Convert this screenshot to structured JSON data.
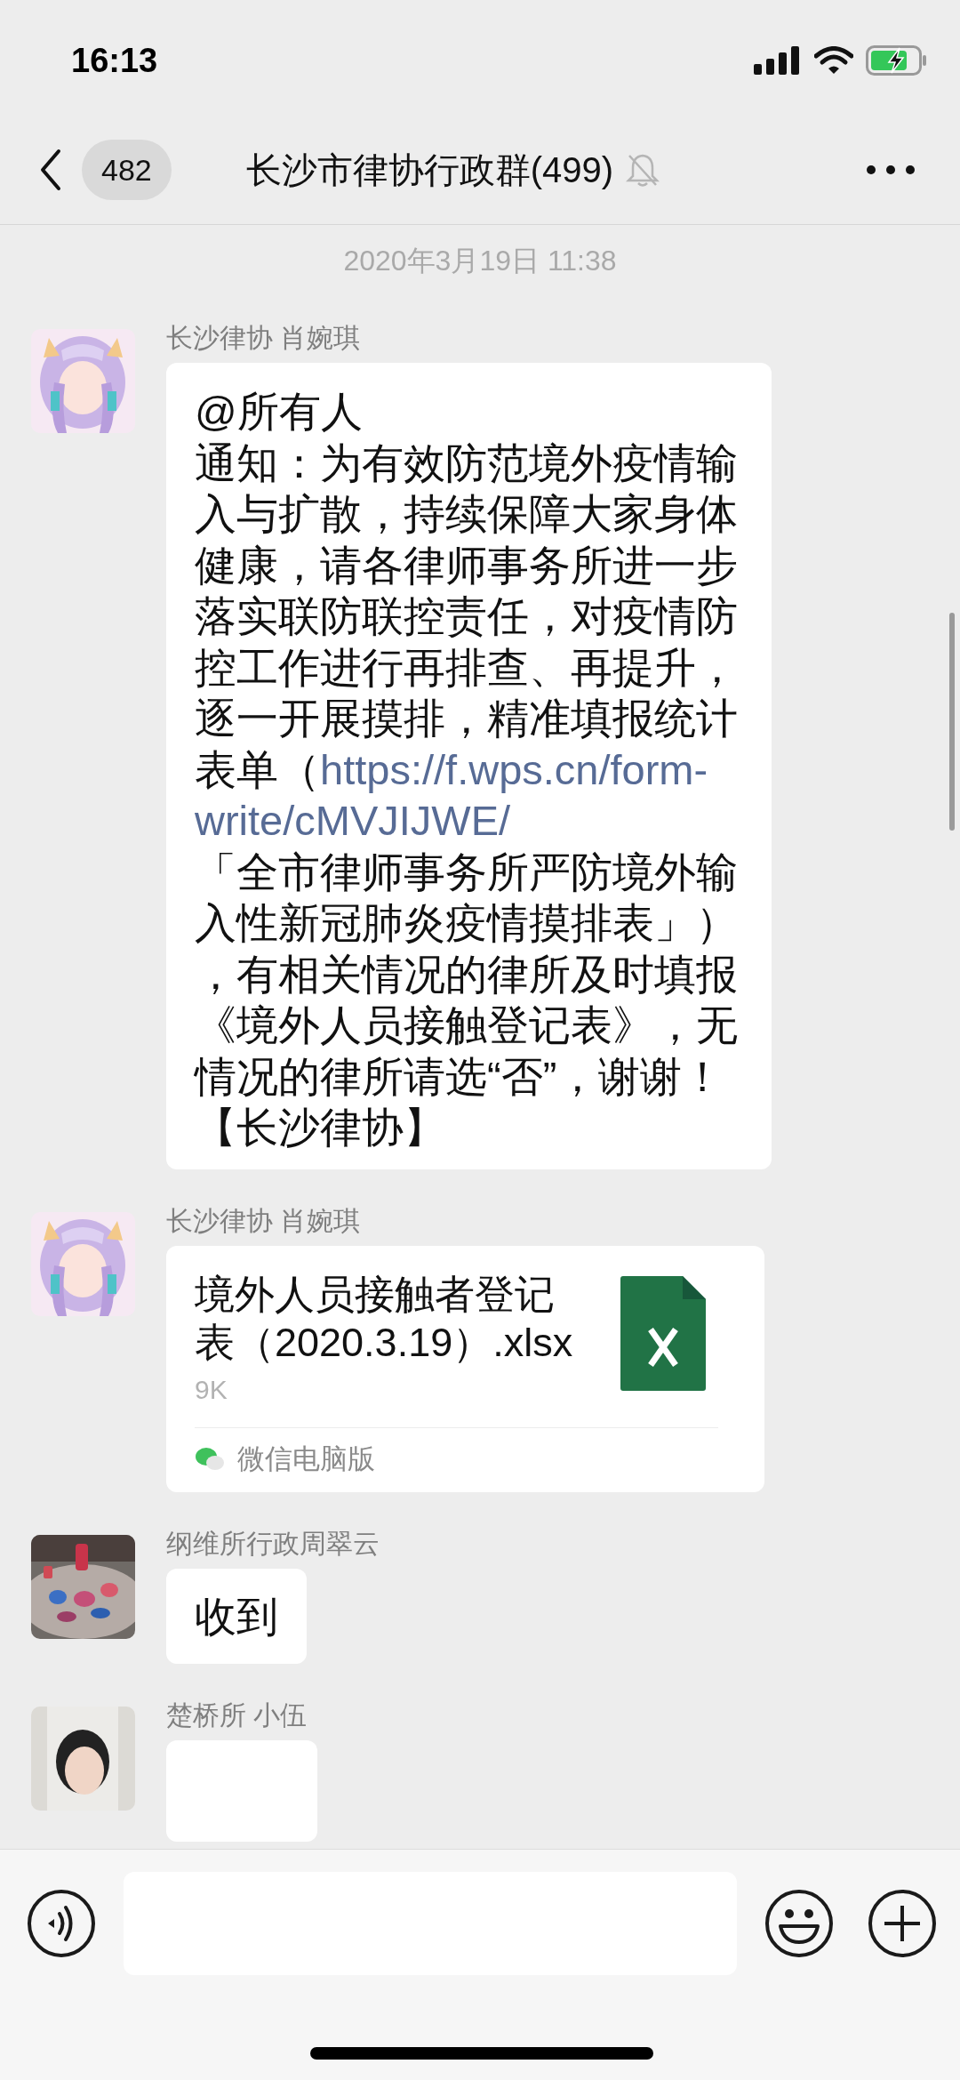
{
  "status_bar": {
    "time": "16:13"
  },
  "nav": {
    "back_badge": "482",
    "title": "长沙市律协行政群(499)",
    "muted": true
  },
  "timestamp": "2020年3月19日 11:38",
  "messages": [
    {
      "kind": "text",
      "sender": "长沙律协 肖婉琪",
      "avatar": {
        "kind": "illustration"
      },
      "segments": [
        {
          "kind": "plain",
          "text": "@所有人"
        },
        {
          "kind": "break"
        },
        {
          "kind": "plain",
          "text": "通知：为有效防范境外疫情输入与扩散，持续保障大家身体健康，请各律师事务所进一步落实联防联控责任，对疫情防控工作进行再排查、再提升，逐一开展摸排，精准填报统计表单（"
        },
        {
          "kind": "link",
          "text": "https://f.wps.cn/form-"
        },
        {
          "kind": "link",
          "text": "write/cMVJIJWE/"
        },
        {
          "kind": "break"
        },
        {
          "kind": "plain",
          "text": "「全市律师事务所严防境外输入性新冠肺炎疫情摸排表」），有相关情况的律所及时填报《境外人员接触登记表》，无情况的律所请选“否”，谢谢！【长沙律协】"
        }
      ]
    },
    {
      "kind": "file",
      "sender": "长沙律协 肖婉琪",
      "avatar": {
        "kind": "illustration"
      },
      "file_name": "境外人员接触者登记表（2020.3.19）.xlsx",
      "file_size": "9K",
      "source": "微信电脑版"
    },
    {
      "kind": "text",
      "sender": "纲维所行政周翠云",
      "segments": [
        {
          "kind": "plain",
          "text": "收到"
        }
      ]
    },
    {
      "kind": "cut",
      "sender": "楚桥所 小伍",
      "avatar": {
        "kind": "person"
      }
    }
  ]
}
